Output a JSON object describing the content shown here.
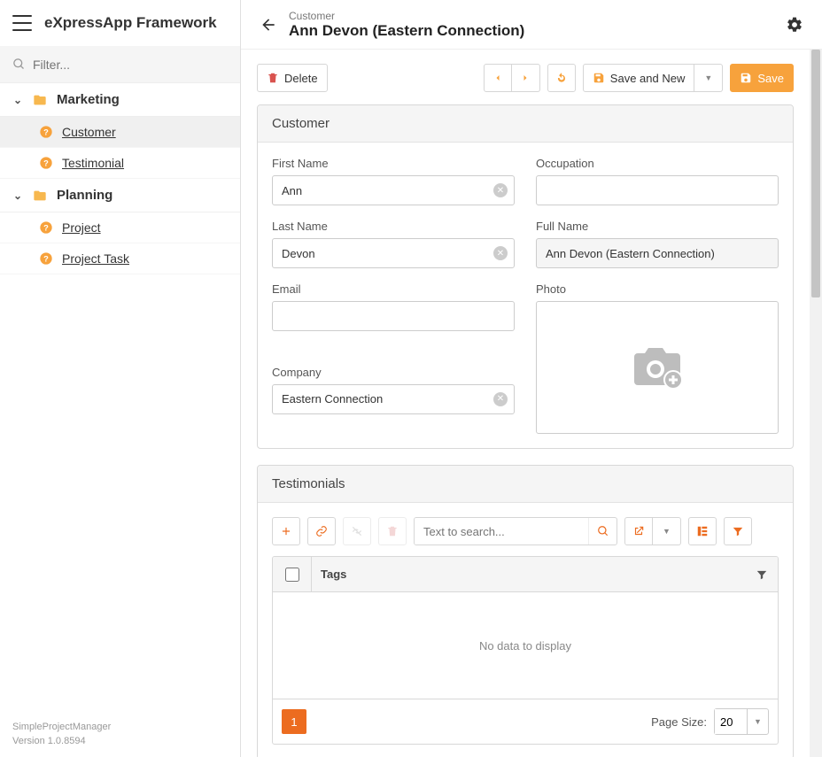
{
  "brand": "eXpressApp Framework",
  "filter_placeholder": "Filter...",
  "nav": {
    "groups": [
      {
        "label": "Marketing",
        "items": [
          {
            "label": "Customer",
            "active": true
          },
          {
            "label": "Testimonial",
            "active": false
          }
        ]
      },
      {
        "label": "Planning",
        "items": [
          {
            "label": "Project",
            "active": false
          },
          {
            "label": "Project Task",
            "active": false
          }
        ]
      }
    ]
  },
  "footer": {
    "project": "SimpleProjectManager",
    "version": "Version 1.0.8594"
  },
  "header": {
    "crumb": "Customer",
    "title": "Ann Devon (Eastern Connection)"
  },
  "toolbar": {
    "delete": "Delete",
    "save_and_new": "Save and New",
    "save": "Save"
  },
  "cards": {
    "customer": "Customer",
    "testimonials": "Testimonials"
  },
  "form": {
    "first_name_label": "First Name",
    "first_name": "Ann",
    "occupation_label": "Occupation",
    "occupation": "",
    "last_name_label": "Last Name",
    "last_name": "Devon",
    "full_name_label": "Full Name",
    "full_name": "Ann Devon (Eastern Connection)",
    "email_label": "Email",
    "email": "",
    "photo_label": "Photo",
    "company_label": "Company",
    "company": "Eastern Connection"
  },
  "grid": {
    "search_placeholder": "Text to search...",
    "tags_col": "Tags",
    "no_data": "No data to display",
    "page": "1",
    "page_size_label": "Page Size:",
    "page_size": "20"
  },
  "colors": {
    "accent": "#f7a23c",
    "accent_dark": "#ec6c20"
  }
}
